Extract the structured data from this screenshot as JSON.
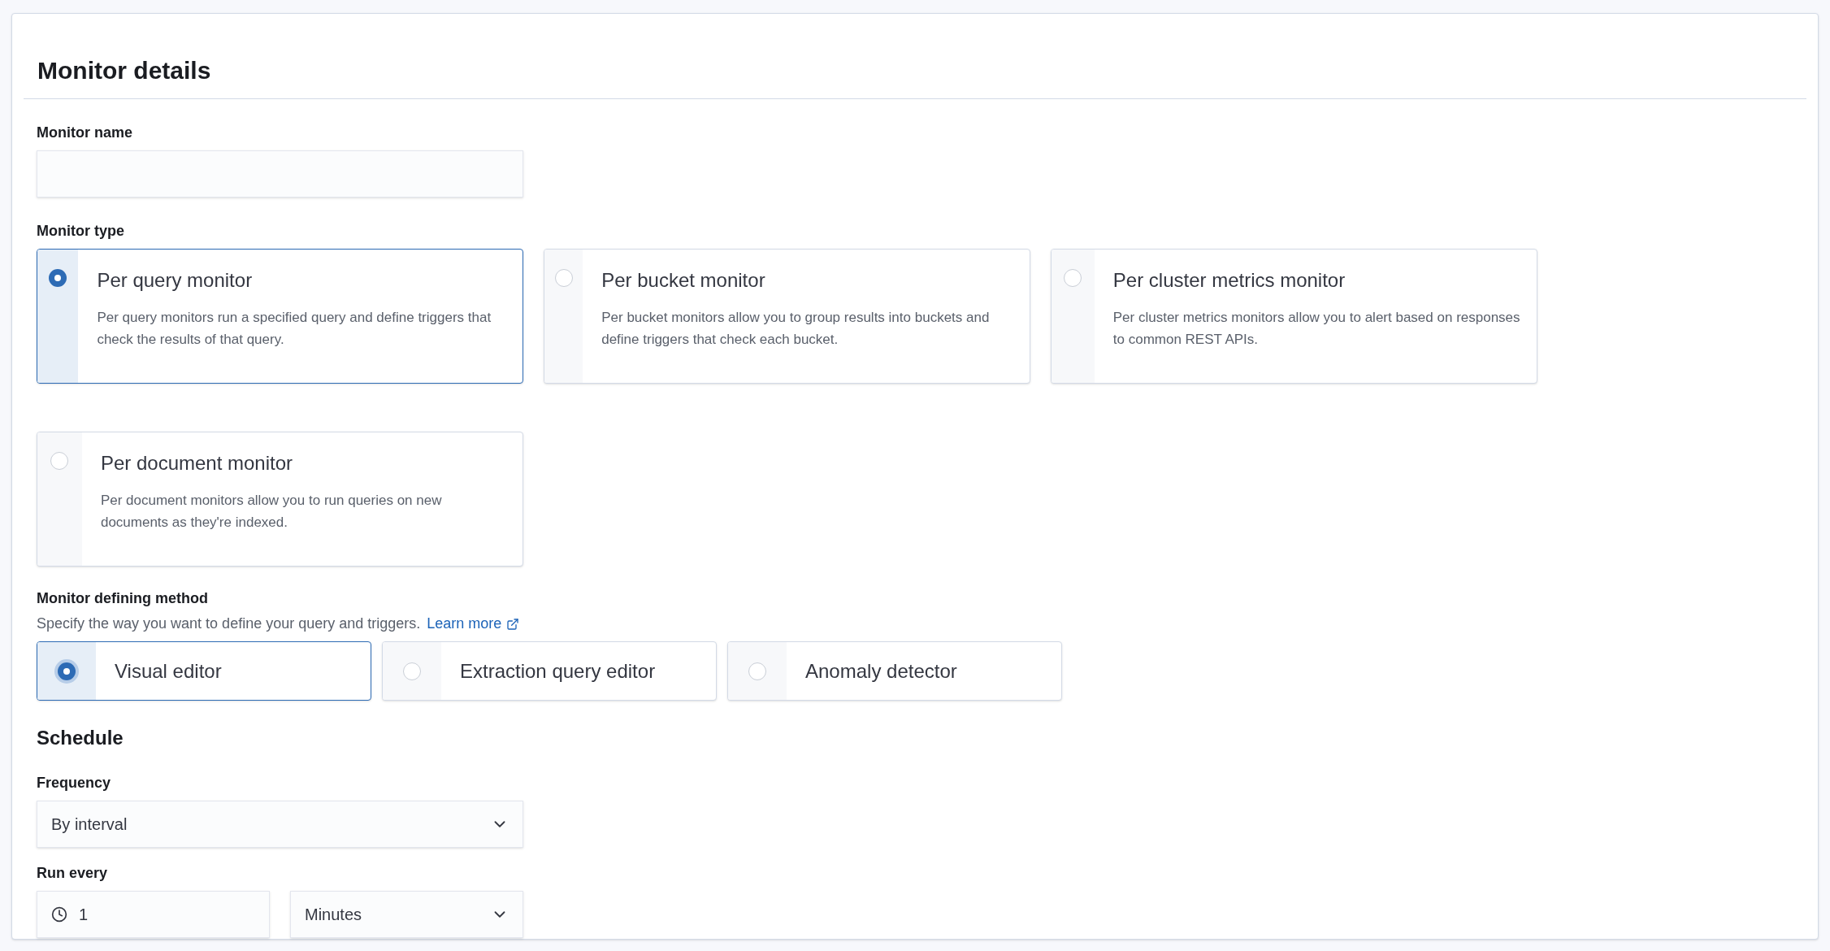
{
  "title": "Monitor details",
  "monitor_name": {
    "label": "Monitor name"
  },
  "monitor_type": {
    "label": "Monitor type",
    "options": [
      {
        "title": "Per query monitor",
        "description": "Per query monitors run a specified query and define triggers that check the results of that query.",
        "selected": true
      },
      {
        "title": "Per bucket monitor",
        "description": "Per bucket monitors allow you to group results into buckets and define triggers that check each bucket.",
        "selected": false
      },
      {
        "title": "Per cluster metrics monitor",
        "description": "Per cluster metrics monitors allow you to alert based on responses to common REST APIs.",
        "selected": false
      },
      {
        "title": "Per document monitor",
        "description": "Per document monitors allow you to run queries on new documents as they're indexed.",
        "selected": false
      }
    ]
  },
  "defining_method": {
    "label": "Monitor defining method",
    "help": "Specify the way you want to define your query and triggers.",
    "link": "Learn more",
    "options": [
      {
        "label": "Visual editor",
        "selected": true
      },
      {
        "label": "Extraction query editor",
        "selected": false
      },
      {
        "label": "Anomaly detector",
        "selected": false
      }
    ]
  },
  "schedule": {
    "title": "Schedule",
    "frequency": {
      "label": "Frequency",
      "value": "By interval"
    },
    "run_every": {
      "label": "Run every",
      "value": "1",
      "unit": "Minutes"
    }
  }
}
